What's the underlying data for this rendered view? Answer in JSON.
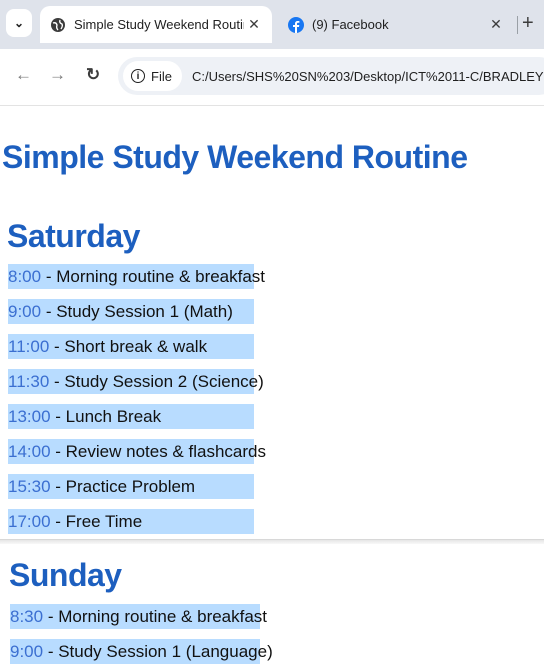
{
  "browser": {
    "tabs": [
      {
        "title": "Simple Study Weekend Routine",
        "active": true,
        "icon": "globe-icon"
      },
      {
        "title": "(9) Facebook",
        "active": false,
        "icon": "facebook-icon"
      }
    ],
    "address": {
      "chip_label": "File",
      "url": "C:/Users/SHS%20SN%203/Desktop/ICT%2011-C/BRADLEY"
    }
  },
  "page": {
    "title": "Simple Study Weekend Routine",
    "saturday": {
      "heading": "Saturday",
      "items": [
        {
          "time": "8:00",
          "activity": "Morning routine & breakfast"
        },
        {
          "time": "9:00",
          "activity": "Study Session 1 (Math)"
        },
        {
          "time": "11:00",
          "activity": "Short break & walk"
        },
        {
          "time": "11:30",
          "activity": "Study Session 2 (Science)"
        },
        {
          "time": "13:00",
          "activity": "Lunch Break"
        },
        {
          "time": "14:00",
          "activity": "Review notes & flashcards"
        },
        {
          "time": "15:30",
          "activity": "Practice Problem"
        },
        {
          "time": "17:00",
          "activity": "Free Time"
        }
      ]
    },
    "sunday": {
      "heading": "Sunday",
      "items": [
        {
          "time": "8:30",
          "activity": "Morning routine & breakfast"
        },
        {
          "time": "9:00",
          "activity": "Study Session 1 (Language)"
        }
      ]
    }
  },
  "colors": {
    "heading": "#1d5fbf",
    "highlight": "#b8dcff",
    "time_text": "#3b6fd1"
  }
}
